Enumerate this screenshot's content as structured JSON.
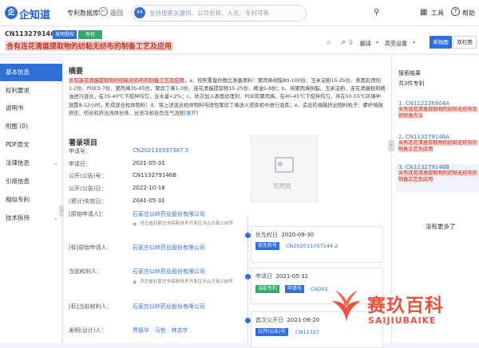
{
  "header": {
    "logo_glyph": "企",
    "brand": "企知道",
    "module": "专利数据库",
    "back_label": "返回",
    "search_badge": "94",
    "search_placeholder": "支持搜索关键词、公司名称、人名、专利号等",
    "tools_label": "工具",
    "help_label": "帮助"
  },
  "titlebar": {
    "publication_number": "CN113279146B",
    "tag_type": "发明授权",
    "tag_status": "有权",
    "title": "含有连花清瘟提取物的纺粘无纺布的制备工艺及应用",
    "translate_label": "翻译",
    "highlight_label": "高亮设置",
    "view_single": "单独图",
    "view_double": "双栏图"
  },
  "sidebar": {
    "items": [
      {
        "label": "基本信息"
      },
      {
        "label": "权利要求"
      },
      {
        "label": "说明书"
      },
      {
        "label": "附图 (0)"
      },
      {
        "label": "PDF原文"
      },
      {
        "label": "法律信息"
      },
      {
        "label": "引用信息"
      },
      {
        "label": "相似专利"
      },
      {
        "label": "技术拆持"
      }
    ]
  },
  "abstract": {
    "heading": "摘要",
    "highlight": "含有连花清瘟提取物的纺粘无纺布的制备工艺及应用",
    "text": "，a、按照重量份数比准备原料：聚丙烯树脂80-100份、玉米淀粉15-25份、表面处理剂1-2份、POE3-7份、聚丙烯35-65份、聚异丁烯1-3份、连花清瘟提取物15-25份、精油5-8份；b、将聚丙烯树脂、玉米淀粉、连花清瘟粉和精油进行混合，在35-40℃下搅拌均匀，含水量<2%；c、依次加入表面处理剂、POE和聚丙烯，在40-45℃下搅拌均匀，并在50-55℃环境中放置8-12小时，形成混合粒体物料；d、将上述混合粒体物料与改性聚异丁烯放入密炼机中进行混炼；e、造出的熔融挤出物料粒子：螺杆熔融挤压、纺丝机挤出流体丝体、丝流冷却自负压气流则",
    "more": "[展开]"
  },
  "record": {
    "heading": "著录项目",
    "fields": [
      {
        "label": "申请号：",
        "value": "CN202110597387.3"
      },
      {
        "label": "申请日：",
        "value": "2021-05-31"
      },
      {
        "label": "公开(公告)号：",
        "value": "CN113279146B"
      },
      {
        "label": "公开(公告)日：",
        "value": "2022-10-18"
      },
      {
        "label": "(预计)失效日：",
        "value": "2041-05-31"
      }
    ],
    "original_applicant_label": "[原始申请人]：",
    "original_applicant": "石家庄以岭药业股份有限公司",
    "original_applicant_addr": "河北省石家庄市高新技术开发区天山大街238号",
    "orig_applicant_label2": "[标]原始申请人：",
    "orig_applicant2": "石家庄以岭药业股份有限公司",
    "current_owner_label": "当前权利人：",
    "current_owner": "石家庄以岭药业股份有限公司",
    "current_owner_addr": "河北省石家庄市高新技术开发区天山大街238号",
    "current_owner_label2": "[标]当前权利人：",
    "current_owner2": "石家庄以岭药业股份有限公司",
    "inventor_label": "发明(设计)人：",
    "inventors": [
      "贾振华",
      "马哲",
      "林志宇"
    ]
  },
  "image": {
    "no_image_label": "无附图"
  },
  "timeline": [
    {
      "title": "优先权日",
      "date": "2020-09-30",
      "tag": "优先权号",
      "link": "CN202011057144.2"
    },
    {
      "title": "申请日",
      "date": "2021-05-31",
      "tag1": "当前专利",
      "tag2": "申请号",
      "link": "CN202"
    },
    {
      "title": "首次公开日",
      "date": "2021-08-20",
      "tag": "公开(公告)号",
      "link": "CN11327"
    }
  ],
  "results": {
    "title": "搜索结果",
    "count": "共3件专利",
    "items": [
      {
        "number": "1. CN112226904A",
        "title": "含有连花清瘟提取物的纺粘无纺布及其制备方法"
      },
      {
        "number": "2. CN113279146A",
        "title": "含有连花清瘟提取物的纺粘无纺布的制备工艺及应用"
      },
      {
        "number": "3. CN113279146B",
        "title": "含有连花清瘟提取物的纺粘无纺布的制备工艺及应用"
      }
    ],
    "no_more": "没有更多了"
  },
  "watermark": {
    "cn": "赛玖百科",
    "en": "SAIJIUBAIKE"
  },
  "colors": {
    "accent": "#2f6fd6",
    "highlight_bg": "#f6d5d3",
    "highlight_text": "#c0392b",
    "valid_green": "#35a86b",
    "watermark": "#e8543f"
  }
}
